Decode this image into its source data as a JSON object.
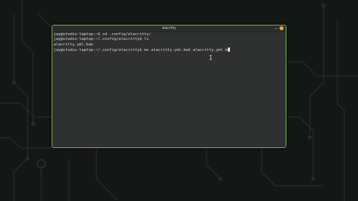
{
  "window": {
    "title": "alacritty"
  },
  "terminal": {
    "lines": [
      {
        "prompt": "jay@studio-laptop:~$",
        "command": " cd .config/alacritty/"
      },
      {
        "prompt": "jay@studio-laptop:~/.config/alacritty$",
        "command": " ls"
      },
      {
        "prompt": "",
        "command": "alacritty.yml.bak"
      },
      {
        "prompt": "jay@studio-laptop:~/.config/alacritty$",
        "command": " mv alacritty.yml.bak alacritty.yml.b"
      }
    ]
  },
  "icons": {
    "minimize": "minimize-icon",
    "close": "close-icon",
    "text_cursor": "ibeam-cursor-icon"
  },
  "colors": {
    "window_border": "#6fbf44",
    "terminal_bg": "#2f3030",
    "terminal_fg": "#dcdcdc",
    "close_button": "#e9a03b",
    "wallpaper_trace": "#233a25"
  }
}
